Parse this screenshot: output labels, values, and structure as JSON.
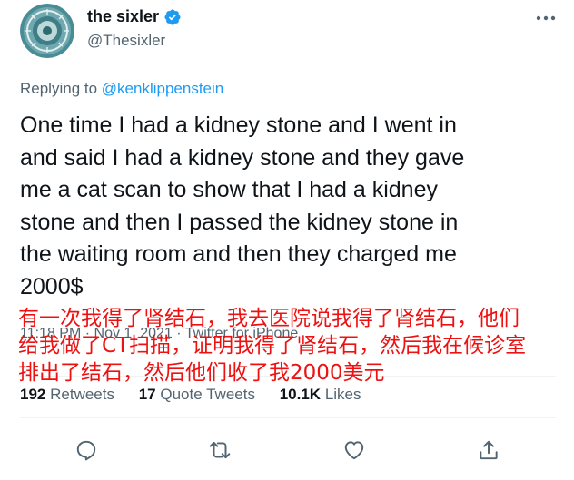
{
  "author": {
    "display_name": "the sixler",
    "handle": "@Thesixler",
    "avatar_icon": "avatar-emblem-icon",
    "verified_icon": "verified-badge-icon"
  },
  "reply": {
    "prefix": "Replying to ",
    "mention": "@kenklippenstein"
  },
  "tweet": {
    "text": "One time I had a kidney stone and I went in\nand said I had a kidney stone and they gave\nme a cat scan to show that I had a kidney\nstone and then I passed the kidney stone in\nthe waiting room and then they charged me\n2000$",
    "time": "11:18 PM",
    "separator": "·",
    "date": "Nov 1, 2021",
    "source": "Twitter for iPhone"
  },
  "stats": {
    "retweets_count": "192",
    "retweets_label": "Retweets",
    "quotes_count": "17",
    "quotes_label": "Quote Tweets",
    "likes_count": "10.1K",
    "likes_label": "Likes"
  },
  "overlay_translation": "有一次我得了肾结石，我去医院说我得了肾结石，他们\n给我做了CT扫描，证明我得了肾结石，然后我在候诊室\n排出了结石，然后他们收了我2000美元",
  "actions": [
    "reply-icon",
    "retweet-icon",
    "like-icon",
    "share-icon"
  ],
  "colors": {
    "text": "#0f1419",
    "secondary": "#536471",
    "link": "#1d9bf0",
    "overlay": "#ee1111",
    "avatar": "#4a8c96"
  }
}
